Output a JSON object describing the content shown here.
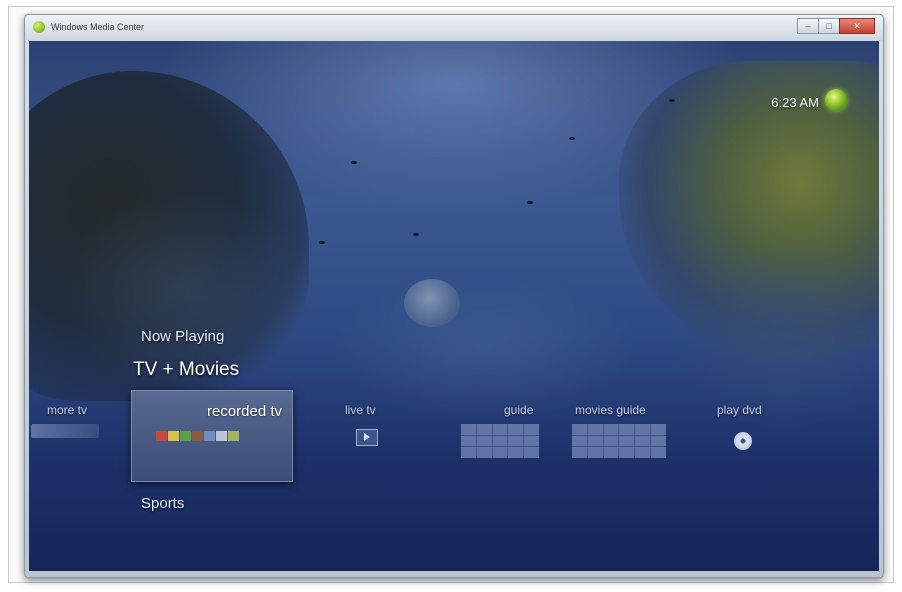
{
  "window": {
    "title": "Windows Media Center",
    "controls": {
      "minimize": "–",
      "maximize": "□",
      "close": "✕"
    }
  },
  "clock": {
    "time": "6:23 AM"
  },
  "menu": {
    "items": [
      "Now Playing",
      "TV + Movies",
      "Sports"
    ],
    "selected": "TV + Movies"
  },
  "strip": {
    "more": "more tv",
    "recorded": "recorded tv",
    "live": "live tv",
    "guide": "guide",
    "movies_guide": "movies guide",
    "play_dvd": "play dvd"
  },
  "icons": {
    "app": "media-center-logo-icon",
    "clock_orb": "windows-orb-icon",
    "live": "play-icon",
    "guide": "grid-icon",
    "movies_guide": "grid-icon",
    "dvd": "disc-icon"
  },
  "colors": {
    "accent": "#7ab82b",
    "background": "#2e4a84",
    "tile": "#4a5d86",
    "close": "#c3432e"
  }
}
